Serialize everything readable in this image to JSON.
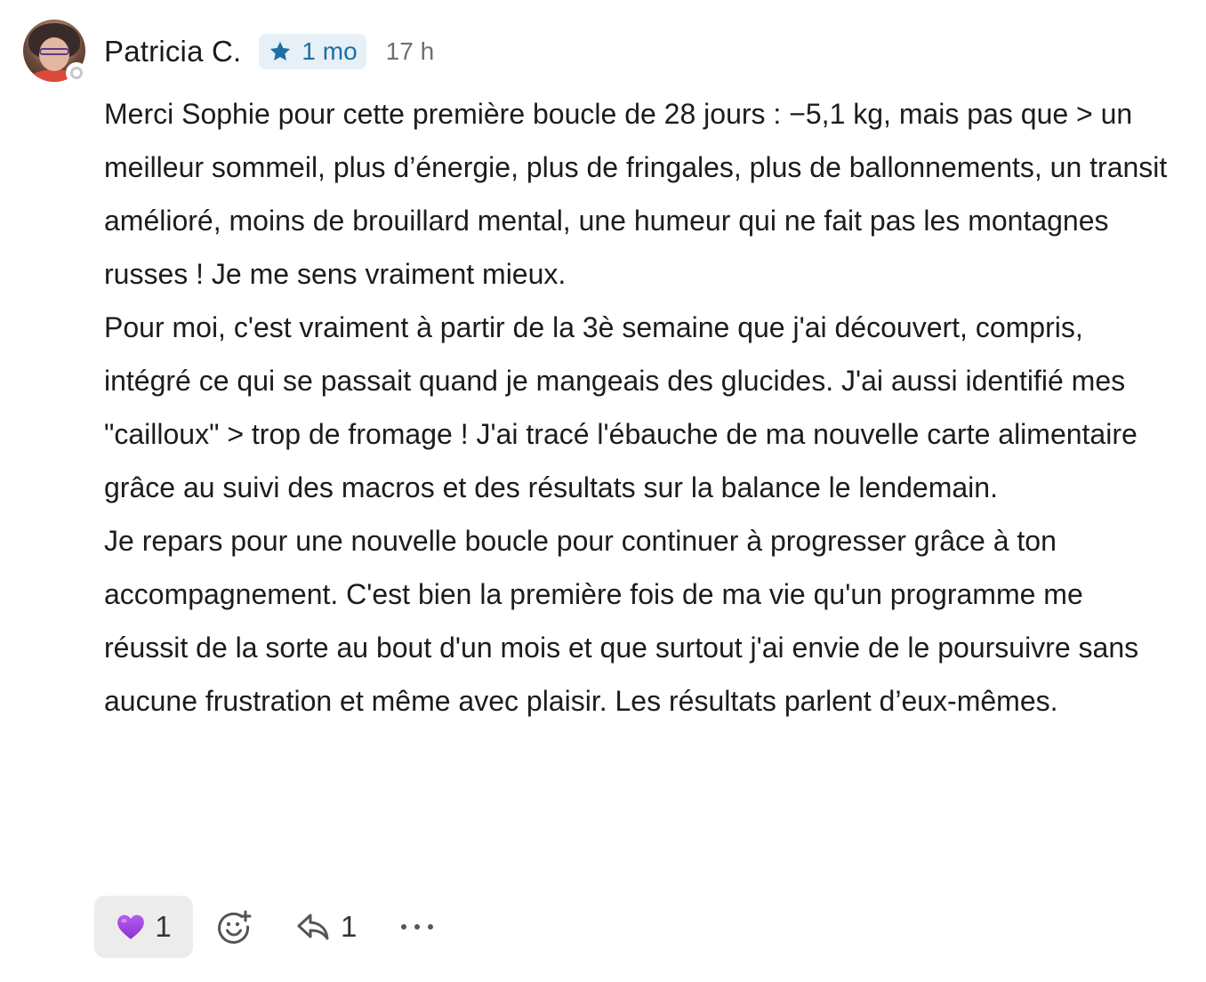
{
  "comment": {
    "author": "Patricia C.",
    "badge_label": "1 mo",
    "badge_icon": "star-icon",
    "timestamp": "17 h",
    "paragraphs": [
      "Merci Sophie pour cette première boucle de 28 jours : −5,1 kg, mais pas que > un meilleur sommeil, plus d’énergie, plus de fringales, plus de ballonnements, un transit amélioré, moins de brouillard mental, une humeur qui ne fait pas les montagnes russes ! Je me sens vraiment mieux.",
      "Pour moi, c'est vraiment à partir de la 3è semaine que j'ai découvert, compris, intégré ce qui se passait quand je mangeais des glucides. J'ai aussi identifié mes \"cailloux\" > trop de fromage ! J'ai tracé l'ébauche de ma nouvelle carte alimentaire grâce au suivi des macros et des résultats sur la balance le lendemain.",
      "Je repars pour une nouvelle boucle pour continuer à progresser grâce à ton accompagnement. C'est bien la première fois de ma vie qu'un programme me réussit de la sorte au bout d'un mois et que surtout j'ai envie de le poursuivre sans aucune frustration et même avec plaisir. Les résultats parlent d’eux-mêmes."
    ]
  },
  "actions": {
    "reaction_icon": "purple-heart-icon",
    "reaction_count": "1",
    "add_reaction_icon": "add-reaction-icon",
    "reply_icon": "reply-icon",
    "reply_count": "1",
    "more_icon": "more-options-icon"
  },
  "colors": {
    "badge_bg": "#e6f0f6",
    "badge_text": "#1e6fa3",
    "heart": "#a24be0",
    "reaction_bg": "#ececec"
  }
}
